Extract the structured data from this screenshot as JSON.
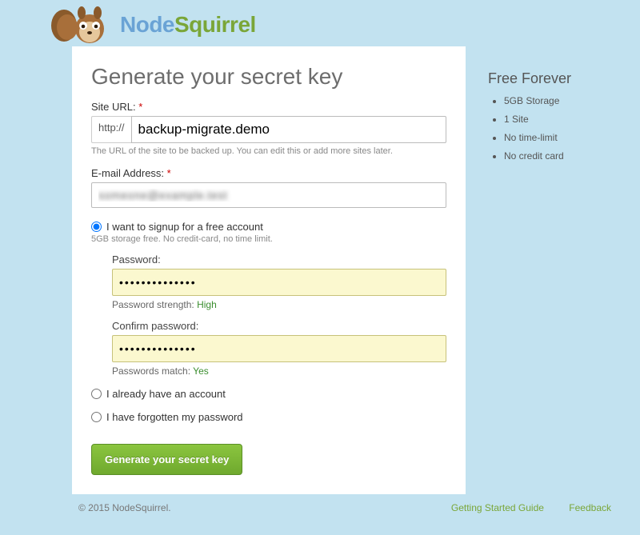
{
  "brand": {
    "name_a": "Node",
    "name_b": "Squirrel"
  },
  "heading": "Generate your secret key",
  "site_url": {
    "label": "Site URL:",
    "required_marker": "*",
    "prefix": "http://",
    "value": "backup-migrate.demo",
    "help": "The URL of the site to be backed up. You can edit this or add more sites later."
  },
  "email": {
    "label": "E-mail Address:",
    "required_marker": "*",
    "value": "someone@example.test"
  },
  "options": {
    "signup": {
      "label": "I want to signup for a free account",
      "sub": "5GB storage free. No credit-card, no time limit.",
      "checked": true
    },
    "have_account": {
      "label": "I already have an account",
      "checked": false
    },
    "forgot": {
      "label": "I have forgotten my password",
      "checked": false
    }
  },
  "password": {
    "label": "Password:",
    "value": "••••••••••••••",
    "strength_label": "Password strength:",
    "strength_value": "High"
  },
  "confirm": {
    "label": "Confirm password:",
    "value": "••••••••••••••",
    "match_label": "Passwords match:",
    "match_value": "Yes"
  },
  "submit_label": "Generate your secret key",
  "sidebar": {
    "title": "Free Forever",
    "items": [
      "5GB Storage",
      "1 Site",
      "No time-limit",
      "No credit card"
    ]
  },
  "footer": {
    "copyright": "© 2015 NodeSquirrel.",
    "links": {
      "guide": "Getting Started Guide",
      "feedback": "Feedback"
    }
  }
}
